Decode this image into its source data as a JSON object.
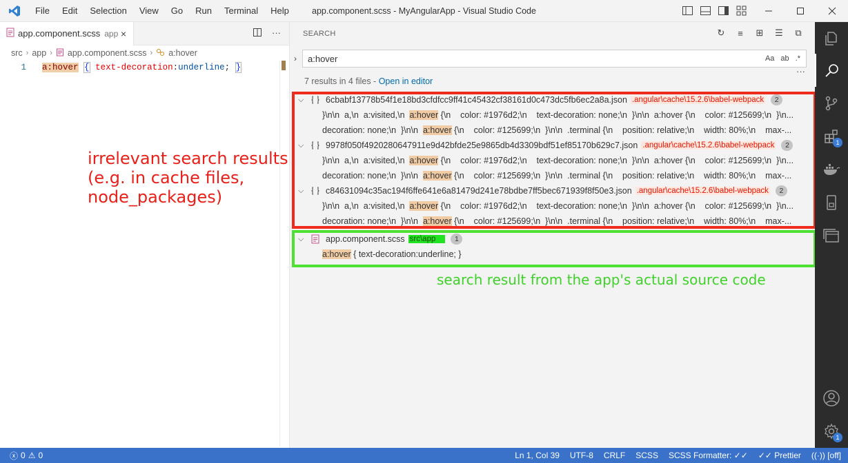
{
  "titlebar": {
    "menu": [
      "File",
      "Edit",
      "Selection",
      "View",
      "Go",
      "Run",
      "Terminal",
      "Help"
    ],
    "title": "app.component.scss - MyAngularApp - Visual Studio Code"
  },
  "editor": {
    "tab": {
      "label": "app.component.scss",
      "description": "app",
      "close": "×"
    },
    "breadcrumb": [
      "src",
      "app",
      "app.component.scss",
      "a:hover"
    ],
    "line_number": "1",
    "code": {
      "selector": "a:hover",
      "open": "{",
      "property": "text-decoration",
      "colon": ":",
      "value": "underline",
      "semi": ";",
      "close": "}"
    }
  },
  "search": {
    "header": "SEARCH",
    "query": "a:hover",
    "options": [
      "Aa",
      "ab",
      ".*"
    ],
    "summary": "7 results in 4 files - ",
    "open_in_editor": "Open in editor",
    "files": [
      {
        "name": "6cbabf13778b54f1e18bd3cfdfcc9ff41c45432cf38161d0c473dc5fb6ec2a8a.json",
        "path": ".angular\\cache\\15.2.6\\babel-webpack",
        "count": "2",
        "matches": [
          {
            "before": "}\\n\\n  a,\\n  a:visited,\\n  ",
            "hit": "a:hover",
            "after": " {\\n    color: #1976d2;\\n    text-decoration: none;\\n  }\\n\\n  a:hover {\\n    color: #125699;\\n  }\\n..."
          },
          {
            "before": "decoration: none;\\n  }\\n\\n  ",
            "hit": "a:hover",
            "after": " {\\n    color: #125699;\\n  }\\n\\n  .terminal {\\n    position: relative;\\n    width: 80%;\\n    max-..."
          }
        ]
      },
      {
        "name": "9978f050f4920280647911e9d42bfde25e9865db4d3309bdf51ef85170b629c7.json",
        "path": ".angular\\cache\\15.2.6\\babel-webpack",
        "count": "2",
        "matches": [
          {
            "before": "}\\n\\n  a,\\n  a:visited,\\n  ",
            "hit": "a:hover",
            "after": " {\\n    color: #1976d2;\\n    text-decoration: none;\\n  }\\n\\n  a:hover {\\n    color: #125699;\\n  }\\n..."
          },
          {
            "before": "decoration: none;\\n  }\\n\\n  ",
            "hit": "a:hover",
            "after": " {\\n    color: #125699;\\n  }\\n\\n  .terminal {\\n    position: relative;\\n    width: 80%;\\n    max-..."
          }
        ]
      },
      {
        "name": "c84631094c35ac194f6ffe641e6a81479d241e78bdbe7ff5bec671939f8f50e3.json",
        "path": ".angular\\cache\\15.2.6\\babel-webpack",
        "count": "2",
        "matches": [
          {
            "before": "}\\n\\n  a,\\n  a:visited,\\n  ",
            "hit": "a:hover",
            "after": " {\\n    color: #1976d2;\\n    text-decoration: none;\\n  }\\n\\n  a:hover {\\n    color: #125699;\\n  }\\n..."
          },
          {
            "before": "decoration: none;\\n  }\\n\\n  ",
            "hit": "a:hover",
            "after": " {\\n    color: #125699;\\n  }\\n\\n  .terminal {\\n    position: relative;\\n    width: 80%;\\n    max-..."
          }
        ]
      }
    ],
    "app_file": {
      "name": "app.component.scss",
      "path": "src\\app",
      "count": "1",
      "match": {
        "hit": "a:hover",
        "after": " { text-decoration:underline; }"
      }
    }
  },
  "annotations": {
    "red_line1": "irrelevant search results",
    "red_line2": "(e.g. in cache files,",
    "red_line3": "node_packages)",
    "green": "search result from the app's actual source code"
  },
  "activity_bar": {
    "extensions_badge": "1",
    "settings_badge": "1"
  },
  "statusbar": {
    "errors": "0",
    "warnings": "0",
    "position": "Ln 1, Col 39",
    "encoding": "UTF-8",
    "eol": "CRLF",
    "language": "SCSS",
    "formatter": "SCSS Formatter: ✓✓",
    "prettier": "✓✓ Prettier",
    "live": "[off]"
  },
  "colors": {
    "status_bar": "#3a72c9",
    "activity_bar": "#2c2c2c",
    "match_highlight": "#f1cba4",
    "annotation_red": "#e8201a",
    "annotation_green": "#3fd12a"
  }
}
